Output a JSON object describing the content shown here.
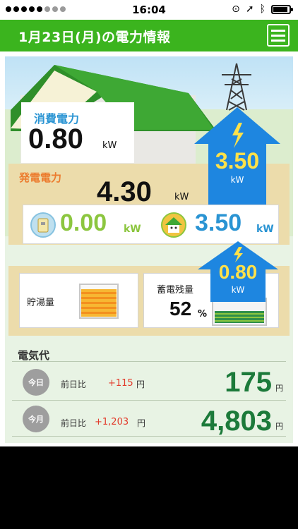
{
  "status_bar": {
    "time": "16:04"
  },
  "header": {
    "title": "1月23日(月)の電力情報"
  },
  "consumption": {
    "label": "消費電力",
    "value": "0.80",
    "unit": "kW"
  },
  "generation": {
    "label": "発電電力",
    "value": "4.30",
    "unit": "kW"
  },
  "grid_arrow": {
    "value": "3.50",
    "unit": "kW"
  },
  "battery_arrow": {
    "value": "0.80",
    "unit": "kW"
  },
  "flows": {
    "self_use": {
      "value": "0.00",
      "unit": "kW"
    },
    "sell": {
      "value": "3.50",
      "unit": "kW"
    }
  },
  "storage": {
    "hot_water": {
      "label": "貯湯量",
      "level": 0.85
    },
    "battery": {
      "label": "蓄電残量",
      "value": "52",
      "unit": "%"
    }
  },
  "bill": {
    "title": "電気代",
    "rows": [
      {
        "period": "今日",
        "compare_label": "前日比",
        "diff": "+115",
        "diff_unit": "円",
        "amount": "175",
        "unit": "円"
      },
      {
        "period": "今月",
        "compare_label": "前日比",
        "diff": "+1,203",
        "diff_unit": "円",
        "amount": "4,803",
        "unit": "円"
      }
    ]
  },
  "colors": {
    "header_green": "#3bb41e",
    "arrow_blue": "#1e86e0",
    "amount_green": "#1c7a3a",
    "diff_red": "#e23a2a",
    "arrow_value_yellow": "#ffe14a"
  }
}
